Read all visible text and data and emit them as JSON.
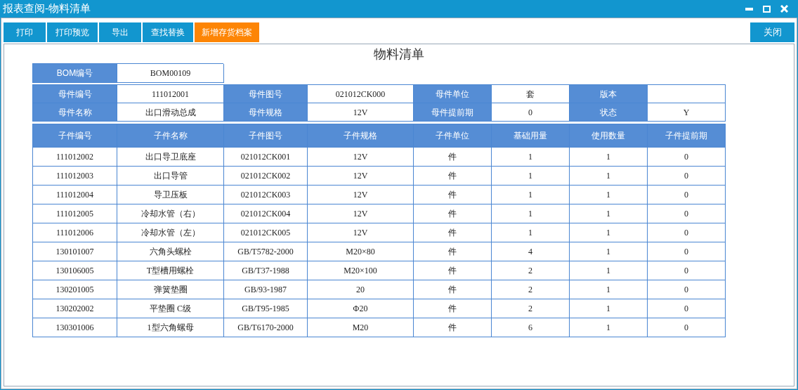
{
  "window": {
    "title": "报表查阅-物料清单"
  },
  "toolbar": {
    "buttons": [
      {
        "label": "打印",
        "highlighted": false
      },
      {
        "label": "打印预览",
        "highlighted": false
      },
      {
        "label": "导出",
        "highlighted": false
      },
      {
        "label": "查找替换",
        "highlighted": false
      },
      {
        "label": "新增存货档案",
        "highlighted": true
      }
    ],
    "close_button": "关闭"
  },
  "report": {
    "title": "物料清单",
    "bom": {
      "label": "BOM编号",
      "value": "BOM00109"
    },
    "parent_rows": [
      [
        {
          "label": "母件编号",
          "value": "111012001"
        },
        {
          "label": "母件图号",
          "value": "021012CK000"
        },
        {
          "label": "母件单位",
          "value": "套"
        },
        {
          "label": "版本"
        }
      ],
      [
        {
          "label": "母件名称",
          "value": "出口滑动总成"
        },
        {
          "label": "母件规格",
          "value": "12V"
        },
        {
          "label": "母件提前期",
          "value": "0"
        },
        {
          "label": "状态",
          "value": "Y"
        }
      ]
    ],
    "table": {
      "columns": [
        "子件编号",
        "子件名称",
        "子件图号",
        "子件规格",
        "子件单位",
        "基础用量",
        "使用数量",
        "子件提前期"
      ],
      "rows": [
        [
          "111012002",
          "出口导卫底座",
          "021012CK001",
          "12V",
          "件",
          "1",
          "1",
          "0"
        ],
        [
          "111012003",
          "出口导管",
          "021012CK002",
          "12V",
          "件",
          "1",
          "1",
          "0"
        ],
        [
          "111012004",
          "导卫压板",
          "021012CK003",
          "12V",
          "件",
          "1",
          "1",
          "0"
        ],
        [
          "111012005",
          "冷却水管（右）",
          "021012CK004",
          "12V",
          "件",
          "1",
          "1",
          "0"
        ],
        [
          "111012006",
          "冷却水管（左）",
          "021012CK005",
          "12V",
          "件",
          "1",
          "1",
          "0"
        ],
        [
          "130101007",
          "六角头螺栓",
          "GB/T5782-2000",
          "M20×80",
          "件",
          "4",
          "1",
          "0"
        ],
        [
          "130106005",
          "T型槽用螺栓",
          "GB/T37-1988",
          "M20×100",
          "件",
          "2",
          "1",
          "0"
        ],
        [
          "130201005",
          "弹簧垫圈",
          "GB/93-1987",
          "20",
          "件",
          "2",
          "1",
          "0"
        ],
        [
          "130202002",
          "平垫圈 C级",
          "GB/T95-1985",
          "Φ20",
          "件",
          "2",
          "1",
          "0"
        ],
        [
          "130301006",
          "1型六角螺母",
          "GB/T6170-2000",
          "M20",
          "件",
          "6",
          "1",
          "0"
        ]
      ]
    }
  }
}
